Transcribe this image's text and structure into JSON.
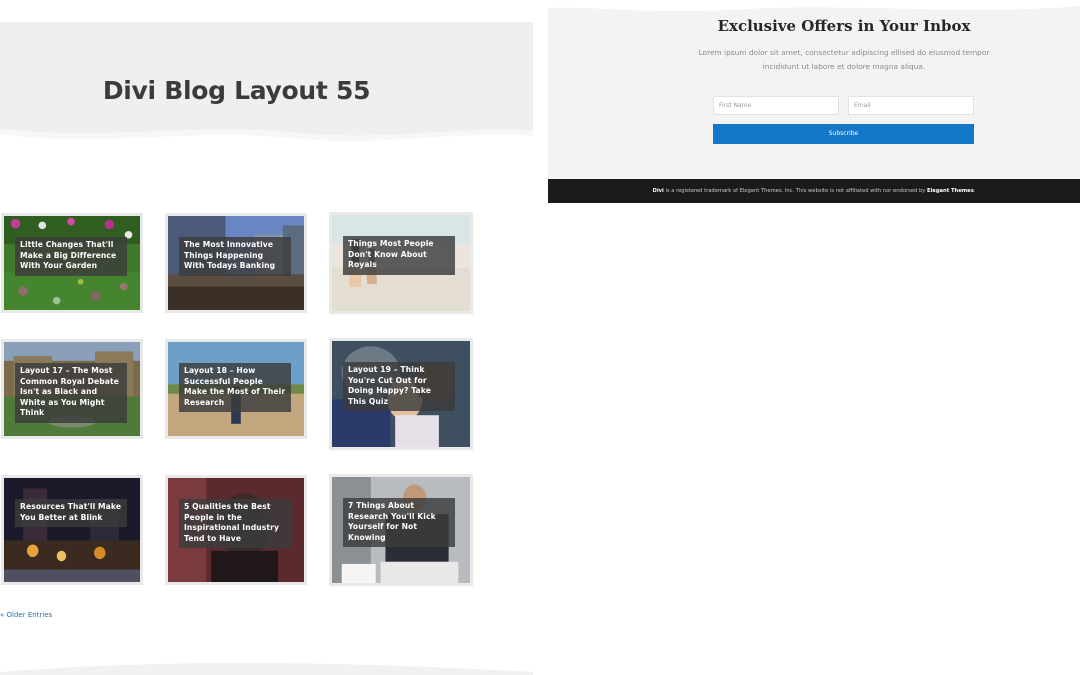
{
  "hero": {
    "title": "Divi Blog Layout 55"
  },
  "posts": [
    {
      "title": "Little Changes That'll Make a Big Difference With Your Garden",
      "image": "flower-garden"
    },
    {
      "title": "The Most Innovative Things Happening With Todays Banking",
      "image": "city-buildings"
    },
    {
      "title": "Things Most People Don't Know About Royals",
      "image": "beach-family"
    },
    {
      "title": "Layout 17 – The Most Common Royal Debate Isn't as Black and White as You Might Think",
      "image": "palace-garden"
    },
    {
      "title": "Layout 18 – How Successful People Make the Most of Their Research",
      "image": "person-on-road"
    },
    {
      "title": "Layout 19 – Think You're Cut Out for Doing Happy? Take This Quiz",
      "image": "mother-child"
    },
    {
      "title": "Resources That'll Make You Better at Blink",
      "image": "night-city"
    },
    {
      "title": "5 Qualities the Best People in the Inspirational Industry Tend to Have",
      "image": "person-scarf"
    },
    {
      "title": "7 Things About Research You'll Kick Yourself for Not Knowing",
      "image": "man-laptop"
    }
  ],
  "pagination": {
    "older": "« Older Entries"
  },
  "newsletter": {
    "title": "Exclusive Offers in Your Inbox",
    "desc_line1": "Lorem ipsum dolor sit amet, consectetur adipiscing ellised do eiusmod tempor",
    "desc_line2": "incididunt ut labore et dolore magna aliqua.",
    "first_name_placeholder": "First Name",
    "email_placeholder": "Email",
    "button": "Subscribe"
  },
  "footer": {
    "brand": "Divi",
    "text": " is a registered trademark of Elegant Themes, Inc. This website is not affiliated with nor endorsed by ",
    "company": "Elegant Themes",
    "end": "."
  },
  "colors": {
    "accent": "#1577c8",
    "footer_bg": "#1b1b1b",
    "hero_bg": "#efefef"
  }
}
